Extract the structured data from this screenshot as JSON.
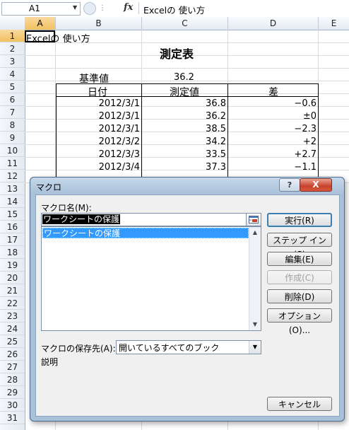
{
  "formula_bar": {
    "name_box": "A1",
    "fx_label": "fx",
    "formula": "Excelの 使い方"
  },
  "columns": [
    "A",
    "B",
    "C",
    "D",
    "E"
  ],
  "rows": [
    "1",
    "2",
    "3",
    "4",
    "5",
    "6",
    "7",
    "8",
    "9",
    "10",
    "11",
    "12",
    "13",
    "14",
    "15",
    "16",
    "17",
    "18",
    "19",
    "20",
    "21",
    "22",
    "23",
    "24",
    "25",
    "26",
    "27",
    "28",
    "29",
    "30",
    "31"
  ],
  "sheet": {
    "a1": "Excelの 使い方",
    "title": "測定表",
    "base_label": "基準値",
    "base_value": "36.2",
    "headers": [
      "日付",
      "測定値",
      "差"
    ],
    "rows": [
      {
        "date": "2012/3/1",
        "value": "36.8",
        "diff": "−0.6"
      },
      {
        "date": "2012/3/1",
        "value": "36.2",
        "diff": "±0"
      },
      {
        "date": "2012/3/1",
        "value": "38.5",
        "diff": "−2.3"
      },
      {
        "date": "2012/3/2",
        "value": "34.2",
        "diff": "+2"
      },
      {
        "date": "2012/3/3",
        "value": "33.5",
        "diff": "+2.7"
      },
      {
        "date": "2012/3/4",
        "value": "37.3",
        "diff": "−1.1"
      }
    ]
  },
  "dialog": {
    "title": "マクロ",
    "help": "?",
    "close": "X",
    "macro_name_label": "マクロ名(M):",
    "macro_name_value": "ワークシートの保護",
    "macro_list": [
      "ワークシートの保護"
    ],
    "buttons": {
      "run": "実行(R)",
      "step_in": "ステップ イン(S)",
      "edit": "編集(E)",
      "create": "作成(C)",
      "delete": "削除(D)",
      "options": "オプション(O)...",
      "cancel": "キャンセル"
    },
    "store_label": "マクロの保存先(A):",
    "store_value": "開いているすべてのブック",
    "description_label": "説明"
  },
  "colors": {
    "selected_header": "#f1c15f",
    "list_highlight": "#3399ff",
    "dialog_frame": "#a9c0d9",
    "close_button": "#c8412a"
  }
}
